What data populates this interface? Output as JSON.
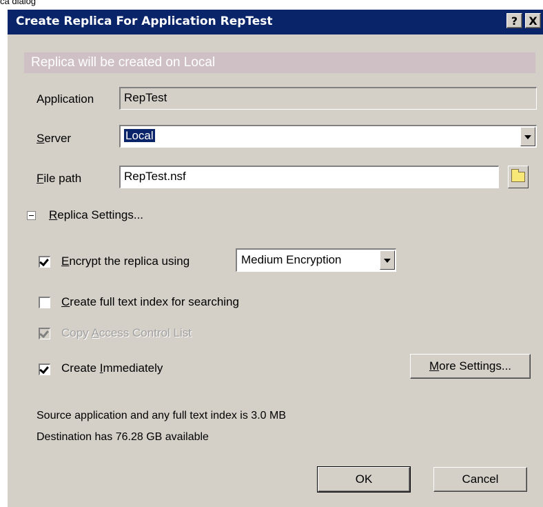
{
  "top_caption": "ca dialog",
  "window": {
    "title": "Create Replica For Application RepTest",
    "help_glyph": "?",
    "close_glyph": "X"
  },
  "banner": "Replica will be created on Local",
  "form": {
    "application_label": "Application",
    "application_value": "RepTest",
    "server_label_u": "S",
    "server_label_rest": "erver",
    "server_value": "Local",
    "filepath_label_u": "F",
    "filepath_label_rest": "ile path",
    "filepath_value": "RepTest.nsf"
  },
  "settings": {
    "section_label_u": "R",
    "section_label_rest": "eplica Settings...",
    "encrypt": {
      "checked": true,
      "label_u": "E",
      "label_rest": "ncrypt the replica using",
      "option_selected": "Medium Encryption"
    },
    "fulltext": {
      "checked": false,
      "label_u": "C",
      "label_rest": "reate full text index for searching"
    },
    "acl": {
      "checked": true,
      "disabled": true,
      "label_pre": "Copy ",
      "label_u": "A",
      "label_rest": "ccess Control List"
    },
    "immediately": {
      "checked": true,
      "label_pre": "Create ",
      "label_u": "I",
      "label_rest": "mmediately"
    },
    "more_settings_u": "M",
    "more_settings_rest": "ore Settings..."
  },
  "info": {
    "source_size": "Source application and any full text index is 3.0 MB",
    "destination_available": "Destination has 76.28 GB available"
  },
  "buttons": {
    "ok": "OK",
    "cancel": "Cancel"
  },
  "colors": {
    "titlebar": "#0a246a",
    "dialog_face": "#d4d0c8",
    "banner": "#cfc0c6",
    "selection": "#0a246a"
  }
}
